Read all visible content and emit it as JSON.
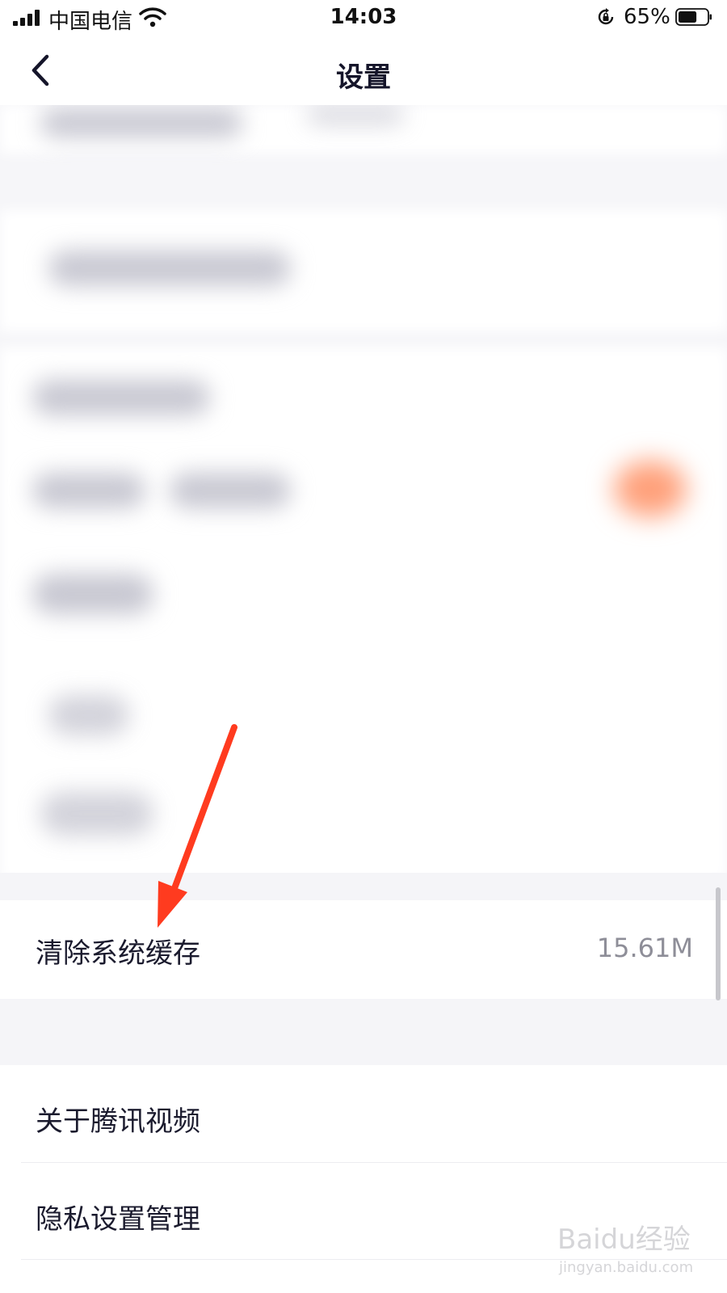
{
  "status_bar": {
    "carrier": "中国电信",
    "time": "14:03",
    "battery_percent": "65%",
    "battery_level": 0.65,
    "signal_icon": "signal-icon",
    "wifi_icon": "wifi-icon",
    "orientation_lock_icon": "orientation-lock-icon",
    "battery_icon": "battery-icon"
  },
  "nav": {
    "title": "设置",
    "back_icon": "chevron-left-icon"
  },
  "settings": {
    "clear_cache": {
      "label": "清除系统缓存",
      "value": "15.61M"
    },
    "about": {
      "label": "关于腾讯视频"
    },
    "privacy": {
      "label": "隐私设置管理"
    }
  },
  "watermark": {
    "brand": "Baidu经验",
    "url": "jingyan.baidu.com"
  },
  "colors": {
    "annotation_arrow": "#ff3b1f",
    "text_primary": "#1b1b2e",
    "text_secondary": "#8e8e98",
    "separator_bg": "#f5f5f8"
  }
}
